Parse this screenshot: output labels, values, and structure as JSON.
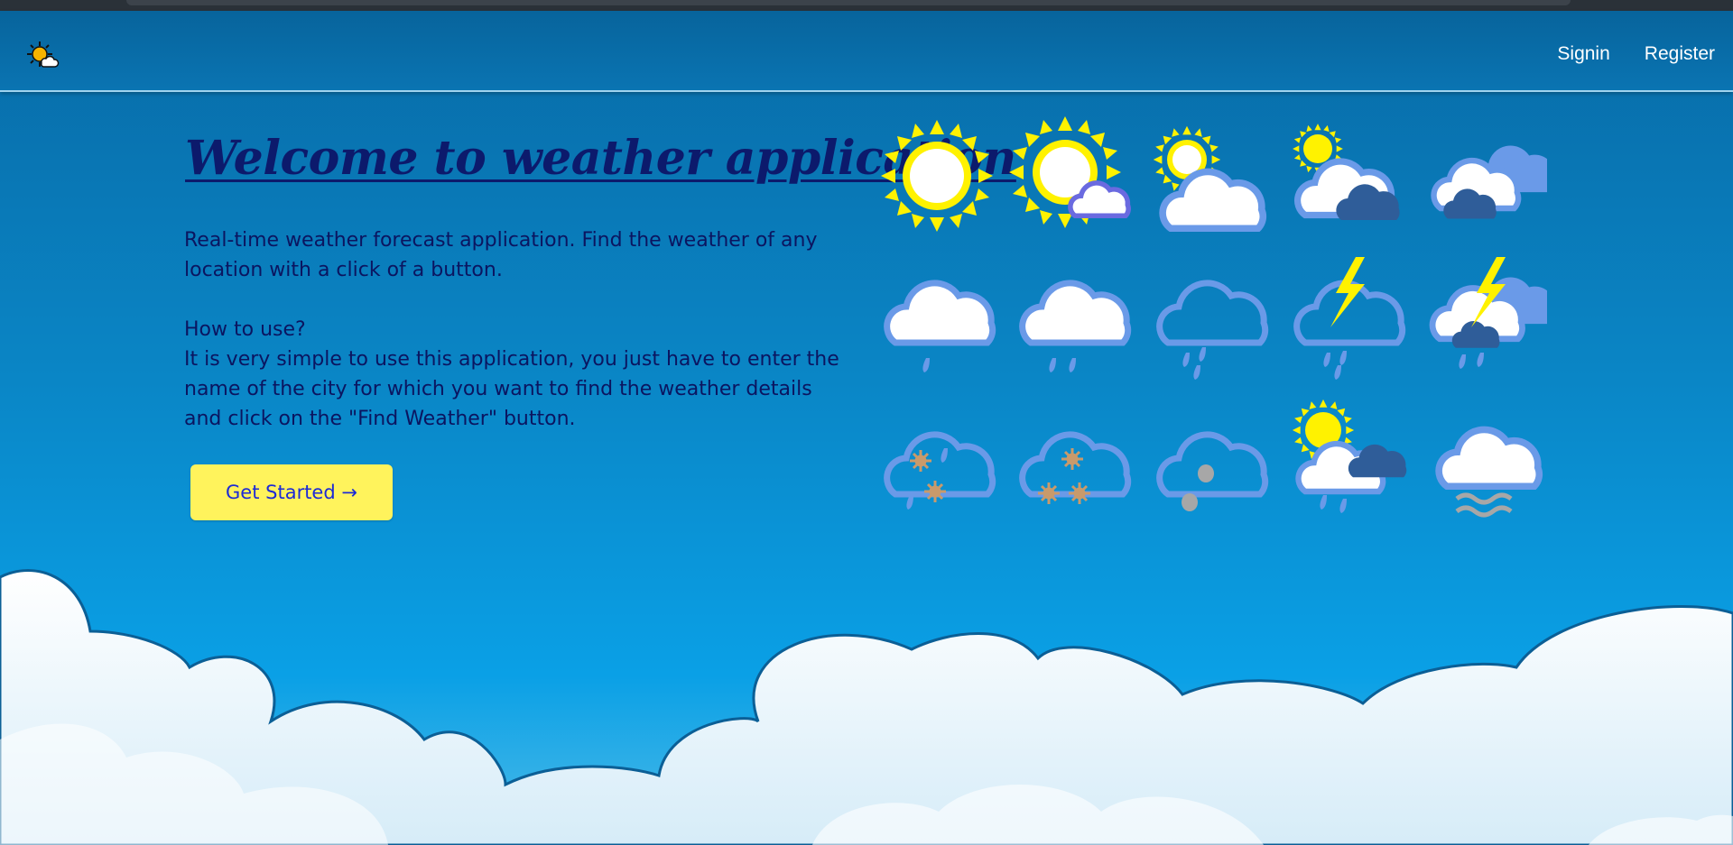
{
  "nav": {
    "logo_icon": "sun-cloud-logo-icon",
    "links": [
      {
        "label": "Signin"
      },
      {
        "label": "Register"
      }
    ]
  },
  "hero": {
    "title": "Welcome to weather application",
    "description": "Real-time weather forecast application. Find the weather of any location with a click of a button.",
    "howto_title": "How to use?",
    "howto_text": "It is very simple to use this application, you just have to enter the name of the city for which you want to find the weather details and click on the \"Find Weather\" button.",
    "cta_label": "Get Started →"
  },
  "weather_icons": [
    "sunny-icon",
    "sun-small-cloud-icon",
    "partly-cloudy-icon",
    "cloudy-dark-cloud-icon",
    "overcast-icon",
    "light-rain-icon",
    "rain-icon",
    "heavy-rain-icon",
    "thunder-rain-icon",
    "thunderstorm-icon",
    "sleet-icon",
    "snow-icon",
    "hail-icon",
    "sun-showers-icon",
    "fog-icon"
  ],
  "colors": {
    "background_top": "#086aa6",
    "background_bottom": "#0aa0e6",
    "title": "#0c1a6c",
    "text": "#0b1560",
    "button_bg": "#fff35c",
    "button_text": "#1c2ad6",
    "sun": "#fff200",
    "cloud_outline": "#5e92e8",
    "dark_cloud": "#2f5d99"
  }
}
